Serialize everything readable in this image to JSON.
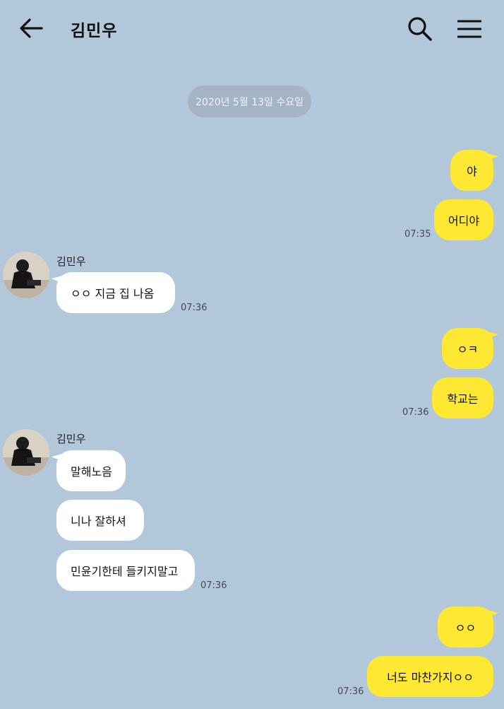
{
  "header": {
    "title": "김민우",
    "back_icon": "arrow-left-icon",
    "search_icon": "search-icon",
    "menu_icon": "hamburger-menu-icon"
  },
  "date_divider": "2020년 5월 13일 수요일",
  "colors": {
    "background": "#b2c7da",
    "my_bubble": "#fee833",
    "their_bubble": "#ffffff",
    "date_pill": "#a3b4c4"
  },
  "messages": {
    "m1": "야",
    "m2": "어디야",
    "t1": "07:35",
    "sender1": "김민우",
    "m3": "ㅇㅇ 지금 집 나옴",
    "t2": "07:36",
    "m4": "ㅇㅋ",
    "m5": "학교는",
    "t3": "07:36",
    "sender2": "김민우",
    "m6": "말해노음",
    "m7": "니나 잘하셔",
    "m8": "민윤기한테 들키지말고",
    "t4": "07:36",
    "m9": "ㅇㅇ",
    "m10": "너도 마찬가지ㅇㅇ",
    "t5": "07:36"
  }
}
